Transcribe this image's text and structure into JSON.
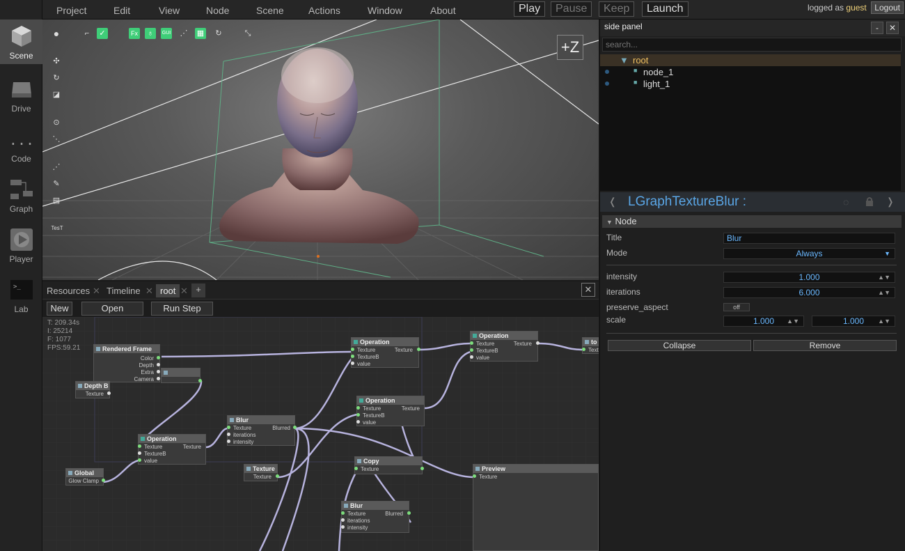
{
  "nav": [
    {
      "label": "Scene",
      "icon": "cube-icon"
    },
    {
      "label": "Drive",
      "icon": "drive-icon"
    },
    {
      "label": "Code",
      "icon": "code-braces-icon"
    },
    {
      "label": "Graph",
      "icon": "graph-icon"
    },
    {
      "label": "Player",
      "icon": "play-icon"
    },
    {
      "label": "Lab",
      "icon": "terminal-icon"
    }
  ],
  "menu": [
    "Project",
    "Edit",
    "View",
    "Node",
    "Scene",
    "Actions",
    "Window",
    "About"
  ],
  "transport": {
    "play": "Play",
    "pause": "Pause",
    "keep": "Keep",
    "launch": "Launch"
  },
  "login": {
    "prefix": "logged as",
    "user": "guest",
    "logout": "Logout"
  },
  "viewport": {
    "axis_label": "+Z",
    "tools_top": [
      "Fx",
      "GUI"
    ],
    "test_label": "TesT"
  },
  "tabs": {
    "items": [
      "Resources",
      "Timeline",
      "root"
    ],
    "add": "+",
    "close": "✕"
  },
  "graph_toolbar": {
    "new": "New",
    "open": "Open",
    "run_step": "Run Step"
  },
  "graph_stats": {
    "t": "T: 209.34s",
    "i": "I: 25214",
    "f": "F: 1077",
    "fps": "FPS:59.21"
  },
  "graph_nodes": {
    "rendered_frame": {
      "title": "Rendered Frame",
      "outputs": [
        "Color",
        "Depth",
        "Extra",
        "Camera"
      ]
    },
    "depth": {
      "title": "Depth B",
      "outputs": [
        "Texture"
      ]
    },
    "global": {
      "title": "Global",
      "outputs": [
        "Glow Clamp"
      ]
    },
    "op1": {
      "title": "Operation",
      "inputs": [
        "Texture",
        "TextureB",
        "value"
      ],
      "outputs": [
        "Texture"
      ]
    },
    "blur1": {
      "title": "Blur",
      "inputs": [
        "Texture",
        "iterations",
        "intensity"
      ],
      "outputs": [
        "Blurred"
      ]
    },
    "texture": {
      "title": "Texture",
      "outputs": [
        "Texture"
      ]
    },
    "op2": {
      "title": "Operation",
      "inputs": [
        "Texture",
        "TextureB",
        "value"
      ],
      "outputs": [
        "Texture"
      ]
    },
    "op3": {
      "title": "Operation",
      "inputs": [
        "Texture",
        "TextureB",
        "value"
      ],
      "outputs": [
        "Texture"
      ]
    },
    "op4": {
      "title": "Operation",
      "inputs": [
        "Texture",
        "TextureB",
        "value"
      ],
      "outputs": [
        "Texture"
      ]
    },
    "copy": {
      "title": "Copy",
      "inputs": [
        "Texture"
      ]
    },
    "blur2": {
      "title": "Blur",
      "inputs": [
        "Texture",
        "iterations",
        "intensity"
      ],
      "outputs": [
        "Blurred"
      ]
    },
    "preview": {
      "title": "Preview",
      "inputs": [
        "Texture"
      ]
    },
    "to": {
      "title": "to",
      "inputs": [
        "Text"
      ]
    }
  },
  "side": {
    "title": "side panel",
    "minimize": "-",
    "close": "✕",
    "search_placeholder": "search...",
    "tree": [
      {
        "label": "root",
        "expander": "▼"
      },
      {
        "label": "node_1",
        "bullet": "■"
      },
      {
        "label": "light_1",
        "bullet": "■"
      }
    ]
  },
  "inspector": {
    "class_name": "LGraphTextureBlur :",
    "prev": "❬",
    "next": "❭",
    "section": "Node",
    "title_label": "Title",
    "title_value": "Blur",
    "mode_label": "Mode",
    "mode_value": "Always",
    "intensity_label": "intensity",
    "intensity_value": "1.000",
    "iterations_label": "iterations",
    "iterations_value": "6.000",
    "preserve_label": "preserve_aspect",
    "preserve_value": "off",
    "scale_label": "scale",
    "scale_x": "1.000",
    "scale_y": "1.000",
    "collapse": "Collapse",
    "remove": "Remove"
  },
  "colors": {
    "accent_green": "#3fce78",
    "accent_blue": "#5aa6e6",
    "root_yellow": "#f0c060"
  }
}
